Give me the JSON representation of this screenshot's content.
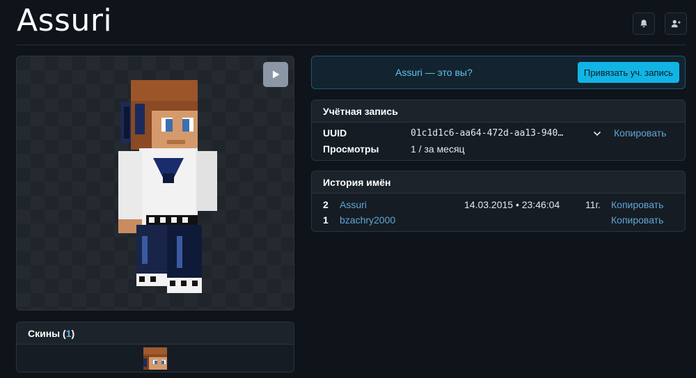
{
  "header": {
    "title": "Assuri",
    "icons": [
      "bell-icon",
      "add-friend-icon"
    ]
  },
  "viewer": {
    "icons": [
      "play-icon"
    ]
  },
  "skins": {
    "label": "Скины",
    "open_paren": "(",
    "count": "1",
    "close_paren": ")"
  },
  "claim": {
    "text": "Assuri — это вы?",
    "button_label": "Привязать уч. запись"
  },
  "account": {
    "heading": "Учётная запись",
    "uuid_label": "UUID",
    "uuid_value": "01c1d1c6-aa64-472d-aa13-940…",
    "copy_label": "Копировать",
    "views_label": "Просмотры",
    "views_value": "1 / за месяц"
  },
  "history": {
    "heading": "История имён",
    "rows": [
      {
        "num": "2",
        "name": "Assuri",
        "date": "14.03.2015 • 23:46:04",
        "age": "11г.",
        "copy": "Копировать"
      },
      {
        "num": "1",
        "name": "bzachry2000",
        "date": "",
        "age": "",
        "copy": "Копировать"
      }
    ]
  },
  "colors": {
    "background": "#0f141b",
    "accent": "#10b5e5",
    "link": "#5fa6d8"
  }
}
